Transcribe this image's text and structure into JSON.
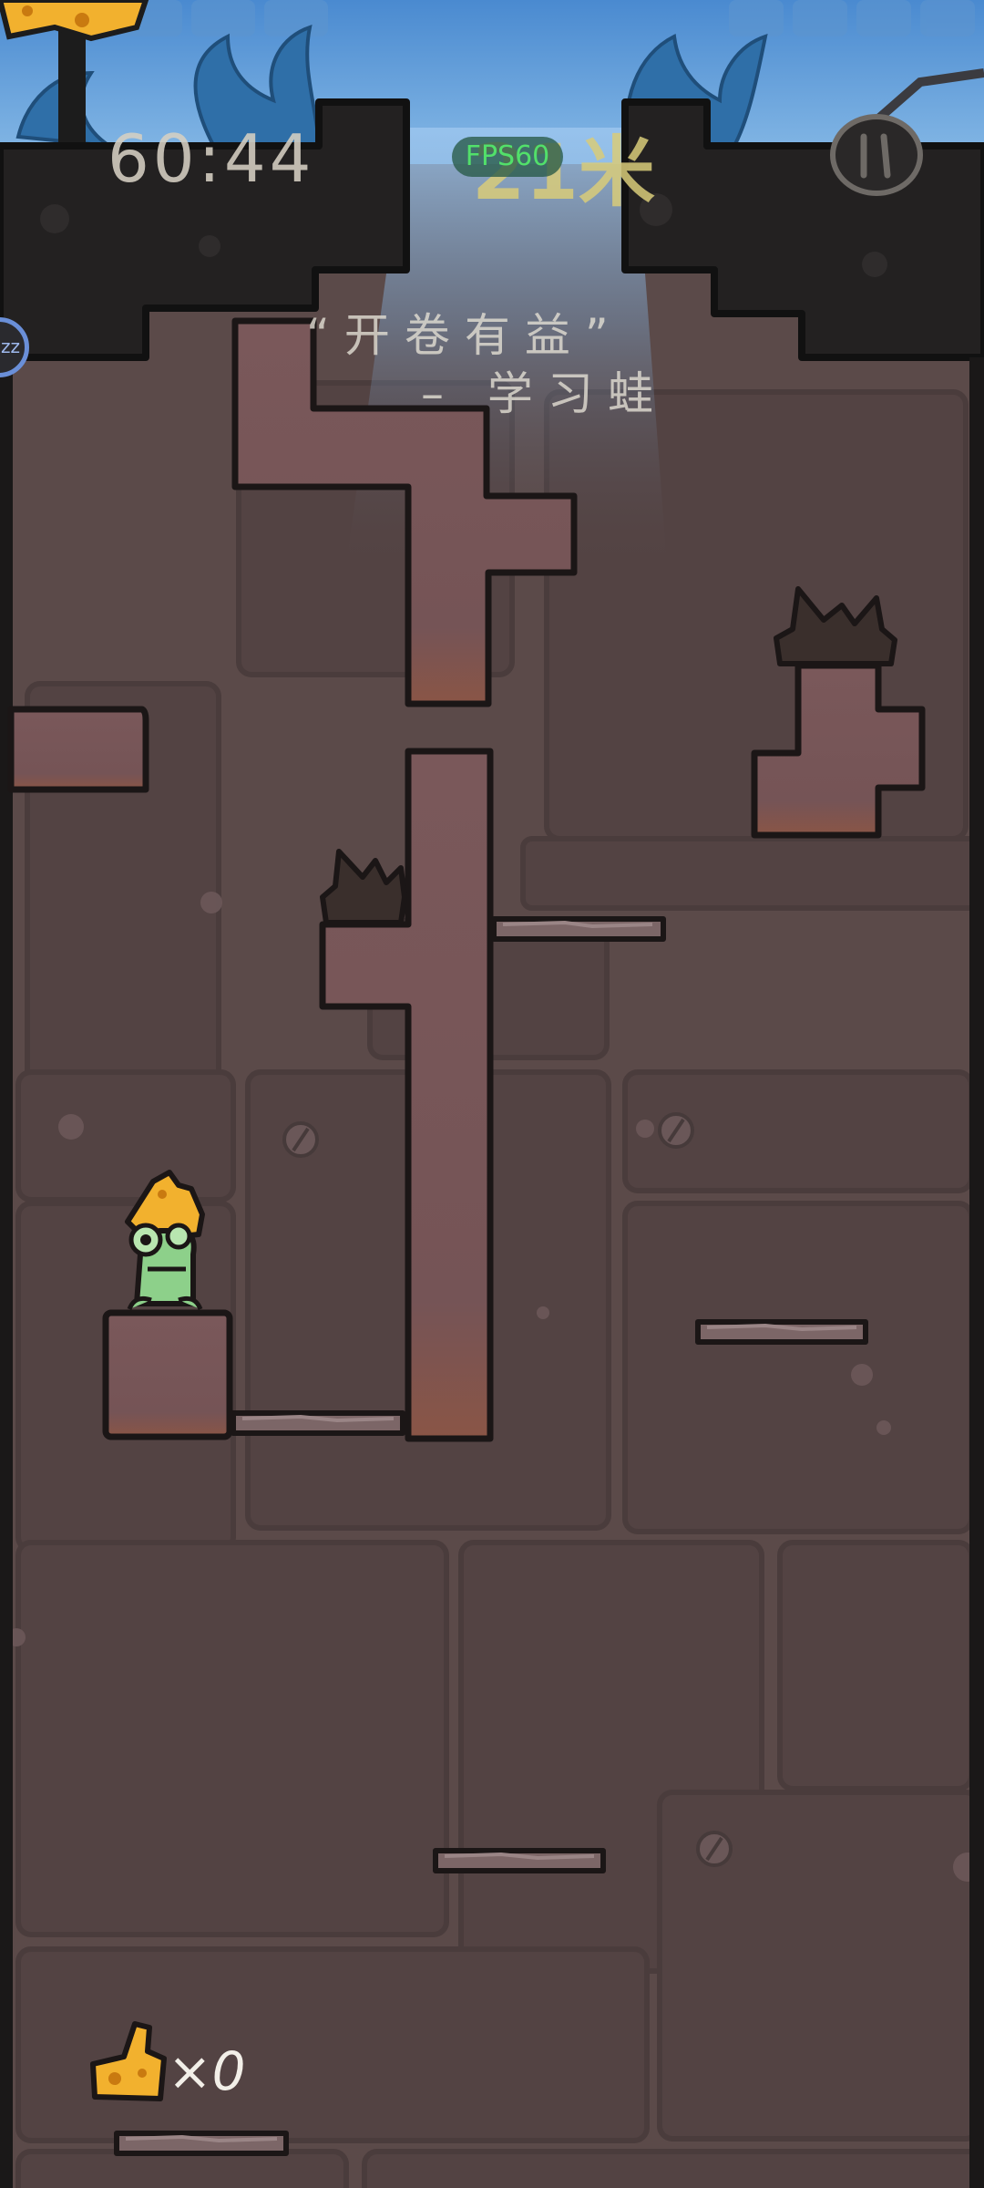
{
  "hud": {
    "timer": "60:44",
    "distance": "21米",
    "fps": "FPS60"
  },
  "quote": {
    "line1": "“开卷有益”",
    "line2": "– 学习蛙"
  },
  "controls": {
    "pause_icon": "pause-icon",
    "sleep_badge": "zz"
  },
  "collectibles": {
    "cheese_icon": "cheese-icon",
    "count": "×0"
  },
  "characters": {
    "frog": "frog-character"
  },
  "colors": {
    "wall_dark": "#232121",
    "brick_bg": "#5b4a49",
    "block_fill": "#725456",
    "sky": "#6da3d8",
    "cheese": "#f2b12e",
    "frog": "#8dd08a"
  }
}
